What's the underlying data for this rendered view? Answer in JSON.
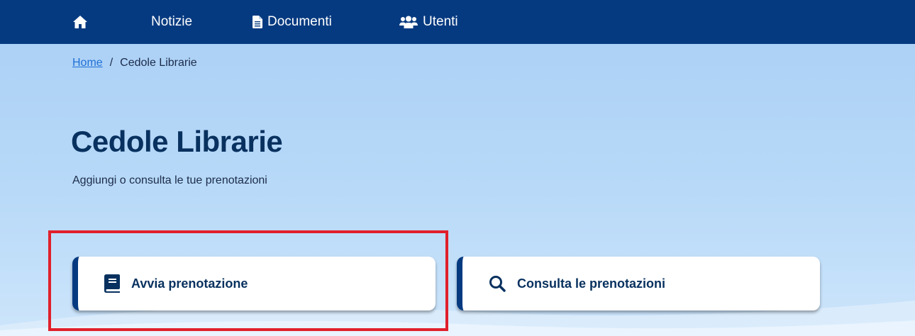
{
  "nav": {
    "home_icon": "home-icon",
    "items": [
      {
        "label": "Notizie"
      },
      {
        "label": "Documenti",
        "icon": "document-icon"
      },
      {
        "label": "Utenti",
        "icon": "users-icon"
      }
    ]
  },
  "breadcrumb": {
    "home": "Home",
    "separator": "/",
    "current": "Cedole Librarie"
  },
  "page": {
    "title": "Cedole Librarie",
    "subtitle": "Aggiungi o consulta le tue prenotazioni"
  },
  "cards": [
    {
      "label": "Avvia prenotazione",
      "icon": "book-icon"
    },
    {
      "label": "Consulta le prenotazioni",
      "icon": "search-icon"
    }
  ],
  "colors": {
    "nav_background": "#063a80",
    "accent": "#063a80",
    "title": "#08315f",
    "link": "#1f6fd6",
    "highlight": "#e0202b"
  }
}
